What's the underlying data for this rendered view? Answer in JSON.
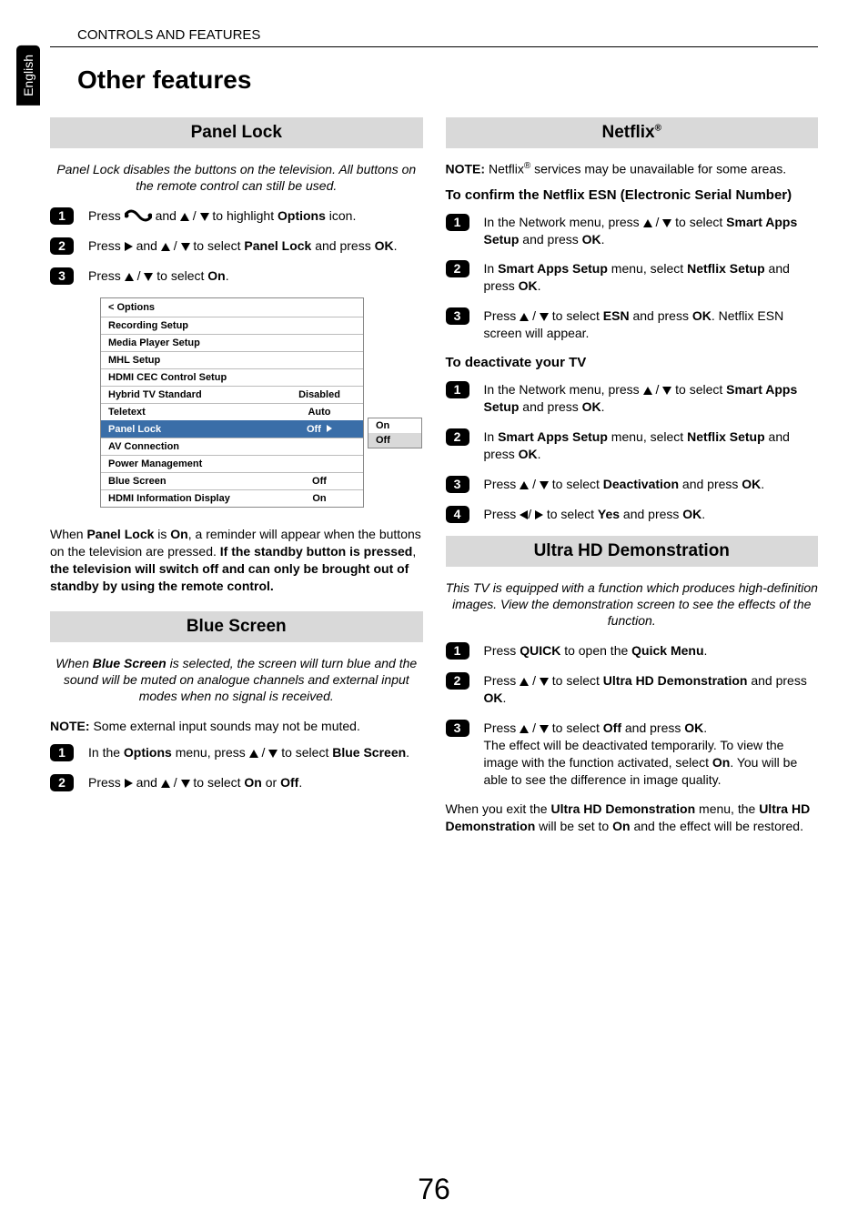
{
  "language_tab": "English",
  "header": "CONTROLS AND FEATURES",
  "page_title": "Other features",
  "page_number": "76",
  "panel_lock": {
    "title": "Panel Lock",
    "desc": "Panel Lock disables the buttons on the television. All buttons on the remote control can still be used.",
    "step1_prefix": "Press ",
    "step1_mid": " and ",
    "step1_suffix1": " / ",
    "step1_suffix2": " to highlight ",
    "step1_bold": "Options",
    "step1_end": " icon.",
    "step2_prefix": "Press ",
    "step2_mid1": " and ",
    "step2_mid2": " / ",
    "step2_mid3": " to select ",
    "step2_bold": "Panel Lock",
    "step2_mid4": " and press ",
    "step2_bold2": "OK",
    "step2_end": ".",
    "step3_prefix": "Press ",
    "step3_mid": " / ",
    "step3_mid2": " to select ",
    "step3_bold": "On",
    "step3_end": ".",
    "after_prefix": "When ",
    "after_b1": "Panel Lock",
    "after_mid1": " is ",
    "after_b2": "On",
    "after_text1": ", a reminder will appear when the buttons on the television are pressed. ",
    "after_b3": "If the standby button is pressed",
    "after_mid2": ", ",
    "after_b4": "the television will switch off and can only be brought out of standby by using the remote control."
  },
  "options_menu": {
    "header": "< Options",
    "rows": [
      {
        "label": "Recording Setup",
        "value": ""
      },
      {
        "label": "Media Player Setup",
        "value": ""
      },
      {
        "label": "MHL Setup",
        "value": ""
      },
      {
        "label": "HDMI CEC Control Setup",
        "value": ""
      },
      {
        "label": "Hybrid TV Standard",
        "value": "Disabled"
      },
      {
        "label": "Teletext",
        "value": "Auto"
      },
      {
        "label": "Panel Lock",
        "value": "Off"
      },
      {
        "label": "AV Connection",
        "value": ""
      },
      {
        "label": "Power Management",
        "value": ""
      },
      {
        "label": "Blue Screen",
        "value": "Off"
      },
      {
        "label": "HDMI Information Display",
        "value": "On"
      }
    ],
    "popup": {
      "opt1": "On",
      "opt2": "Off"
    }
  },
  "blue_screen": {
    "title": "Blue Screen",
    "desc_prefix": "When ",
    "desc_bold": "Blue Screen",
    "desc_rest": " is selected, the screen will turn blue and the sound will be muted on analogue channels and external input modes when no signal is received.",
    "note_bold": "NOTE:",
    "note_text": " Some external input sounds may not be muted.",
    "step1_prefix": "In the ",
    "step1_bold1": "Options",
    "step1_mid": " menu, press ",
    "step1_mid2": " / ",
    "step1_mid3": " to select ",
    "step1_bold2": "Blue Screen",
    "step1_end": ".",
    "step2_prefix": "Press ",
    "step2_mid1": " and ",
    "step2_mid2": " / ",
    "step2_mid3": " to select ",
    "step2_bold1": "On",
    "step2_mid4": " or ",
    "step2_bold2": "Off",
    "step2_end": "."
  },
  "netflix": {
    "title": "Netflix",
    "title_sup": "®",
    "note_bold": "NOTE:",
    "note_text1": " Netflix",
    "note_sup": "®",
    "note_text2": " services may be unavailable for some areas.",
    "sub1": "To confirm the Netflix ESN (Electronic Serial Number)",
    "esn_step1_prefix": "In the Network menu, press ",
    "esn_step1_mid1": " / ",
    "esn_step1_mid2": " to select ",
    "esn_step1_bold1": "Smart Apps Setup",
    "esn_step1_mid3": " and press ",
    "esn_step1_bold2": "OK",
    "esn_step1_end": ".",
    "esn_step2_prefix": "In ",
    "esn_step2_bold1": "Smart Apps Setup",
    "esn_step2_mid1": " menu, select ",
    "esn_step2_bold2": "Netflix Setup",
    "esn_step2_mid2": " and press ",
    "esn_step2_bold3": "OK",
    "esn_step2_end": ".",
    "esn_step3_prefix": "Press ",
    "esn_step3_mid1": " / ",
    "esn_step3_mid2": " to select ",
    "esn_step3_bold1": "ESN",
    "esn_step3_mid3": " and press ",
    "esn_step3_bold2": "OK",
    "esn_step3_end": ". Netflix ESN screen will appear.",
    "sub2": "To deactivate your TV",
    "de_step1_prefix": "In the Network menu, press ",
    "de_step1_mid1": " / ",
    "de_step1_mid2": " to select ",
    "de_step1_bold1": "Smart Apps Setup",
    "de_step1_mid3": " and press ",
    "de_step1_bold2": "OK",
    "de_step1_end": ".",
    "de_step2_prefix": "In ",
    "de_step2_bold1": "Smart Apps Setup",
    "de_step2_mid1": " menu, select ",
    "de_step2_bold2": "Netflix Setup",
    "de_step2_mid2": " and press ",
    "de_step2_bold3": "OK",
    "de_step2_end": ".",
    "de_step3_prefix": "Press ",
    "de_step3_mid1": " / ",
    "de_step3_mid2": " to select ",
    "de_step3_bold1": "Deactivation",
    "de_step3_mid3": " and press ",
    "de_step3_bold2": "OK",
    "de_step3_end": ".",
    "de_step4_prefix": "Press ",
    "de_step4_mid1": "/ ",
    "de_step4_mid2": " to select ",
    "de_step4_bold1": "Yes",
    "de_step4_mid3": " and press ",
    "de_step4_bold2": "OK",
    "de_step4_end": "."
  },
  "uhd": {
    "title": "Ultra HD Demonstration",
    "desc": "This TV is equipped with a function which produces high-definition images. View the demonstration screen to see the effects of the function.",
    "step1_prefix": "Press ",
    "step1_bold1": "QUICK",
    "step1_mid": " to open the ",
    "step1_bold2": "Quick Menu",
    "step1_end": ".",
    "step2_prefix": "Press ",
    "step2_mid1": " / ",
    "step2_mid2": " to select ",
    "step2_bold1": "Ultra HD Demonstration",
    "step2_mid3": " and press ",
    "step2_bold2": "OK",
    "step2_end": ".",
    "step3_prefix": "Press ",
    "step3_mid1": " / ",
    "step3_mid2": " to select ",
    "step3_bold1": "Off",
    "step3_mid3": " and press ",
    "step3_bold2": "OK",
    "step3_end": ".",
    "step3_line2": "The effect will be deactivated temporarily. To view the image with the function activated, select ",
    "step3_bold3": "On",
    "step3_line2b": ". You will be able to see the difference in image quality.",
    "after_prefix": "When you exit the ",
    "after_bold1": "Ultra HD Demonstration",
    "after_mid1": " menu, the ",
    "after_bold2": "Ultra HD Demonstration",
    "after_mid2": " will be set to ",
    "after_bold3": "On",
    "after_end": " and the effect will be restored."
  }
}
